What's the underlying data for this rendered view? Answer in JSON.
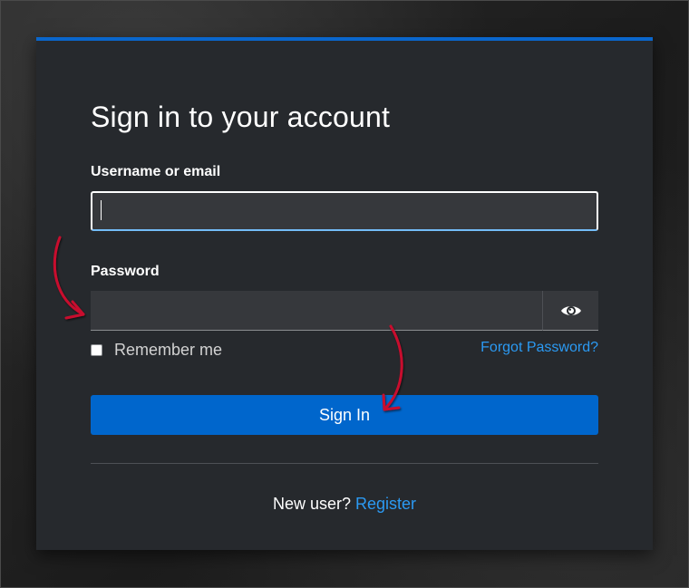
{
  "login": {
    "title": "Sign in to your account",
    "username_label": "Username or email",
    "username_value": "",
    "password_label": "Password",
    "password_value": "",
    "show_password_icon": "eye-icon",
    "remember_label": "Remember me",
    "remember_checked": false,
    "forgot_label": "Forgot Password?",
    "signin_label": "Sign In",
    "new_user_prompt": "New user?",
    "register_label": "Register"
  },
  "colors": {
    "accent": "#0066cc",
    "link": "#2b9af3",
    "card_background": "#26292d",
    "annotation_arrow": "#c8102e"
  }
}
